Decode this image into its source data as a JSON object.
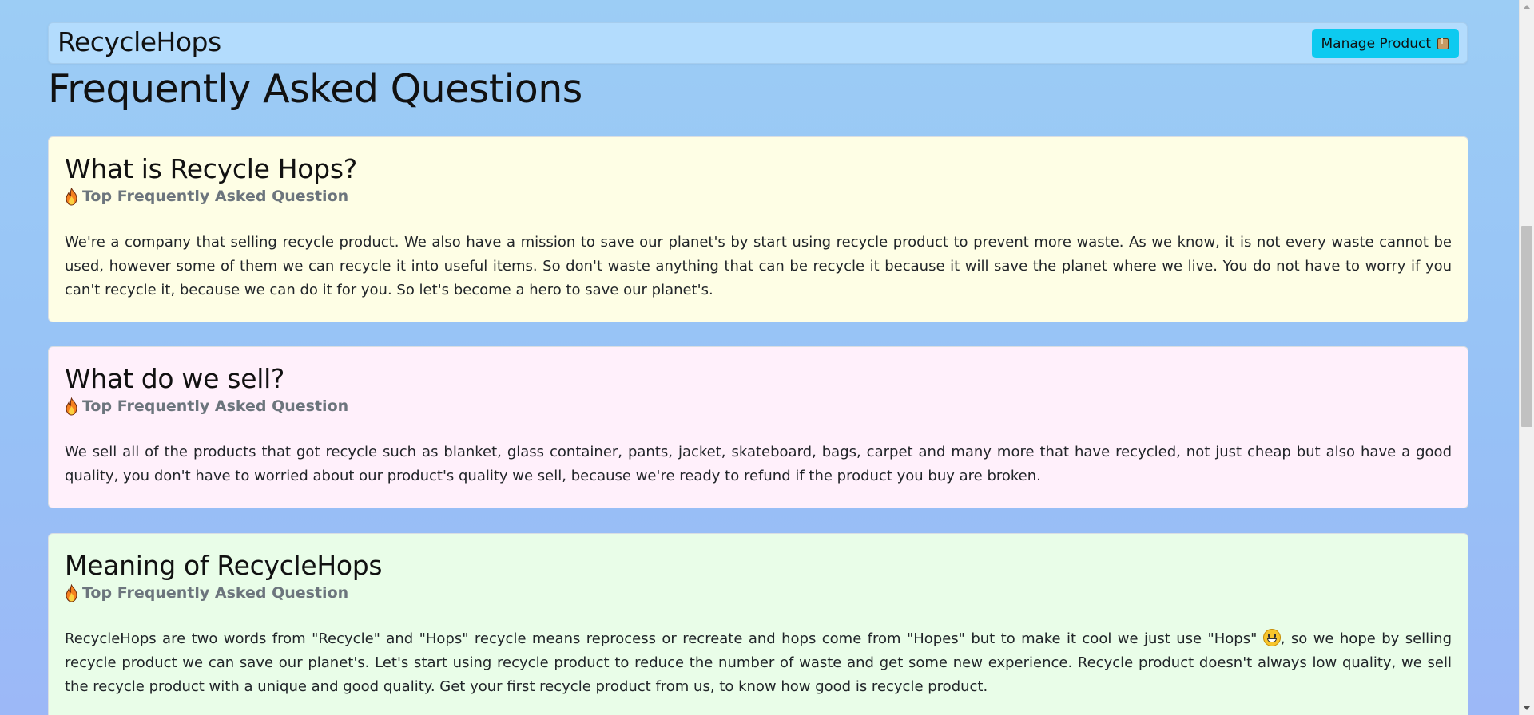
{
  "navbar": {
    "brand": "RecycleHops",
    "manage_button_label": "Manage Product"
  },
  "page": {
    "title": "Frequently Asked Questions"
  },
  "faqs": [
    {
      "question": "What is Recycle Hops?",
      "tag": "Top Frequently Asked Question",
      "answer": "We're a company that selling recycle product. We also have a mission to save our planet's by start using recycle product to prevent more waste. As we know, it is not every waste cannot be used, however some of them we can recycle it into useful items. So don't waste anything that can be recycle it because it will save the planet where we live. You do not have to worry if you can't recycle it, because we can do it for you. So let's become a hero to save our planet's.",
      "background": "#fefee5"
    },
    {
      "question": "What do we sell?",
      "tag": "Top Frequently Asked Question",
      "answer": "We sell all of the products that got recycle such as blanket, glass container, pants, jacket, skateboard, bags, carpet and many more that have recycled, not just cheap but also have a good quality, you don't have to worried about our product's quality we sell, because we're ready to refund if the product you buy are broken.",
      "background": "#fff0fb"
    },
    {
      "question": "Meaning of RecycleHops",
      "tag": "Top Frequently Asked Question",
      "answer_before_emoji": "RecycleHops are two words from \"Recycle\" and \"Hops\" recycle means reprocess or recreate and hops come from \"Hopes\" but to make it cool we just use \"Hops\" ",
      "answer_after_emoji": ", so we hope by selling recycle product we can save our planet's. Let's start using recycle product to reduce the number of waste and get some new experience. Recycle product doesn't always low quality, we sell the recycle product with a unique and good quality. Get your first recycle product from us, to know how good is recycle product.",
      "background": "#e9fde8"
    }
  ],
  "colors": {
    "navbar_bg": "#b3dcfd",
    "button_bg": "#0dcaf0",
    "subtitle_text": "#6c757d"
  },
  "icons": {
    "manage_button": "package-icon",
    "faq_tag": "fire-icon",
    "answer_emoji": "grinning-face-icon"
  }
}
